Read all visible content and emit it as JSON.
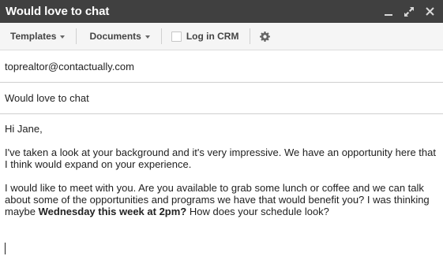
{
  "window": {
    "title": "Would love to chat",
    "controls": [
      {
        "name": "minimize-icon"
      },
      {
        "name": "expand-icon"
      },
      {
        "name": "close-icon"
      }
    ]
  },
  "toolbar": {
    "templates_label": "Templates",
    "documents_label": "Documents",
    "log_in_crm_label": "Log in CRM",
    "log_in_crm_checked": false,
    "settings_icon": "gear-icon"
  },
  "fields": {
    "to": "toprealtor@contactually.com",
    "subject": "Would love to chat"
  },
  "message": {
    "greeting": "Hi Jane,",
    "paragraph1": "I've taken a look at your background and it's very impressive. We have an opportunity here that I think would expand on your experience.",
    "paragraph2_before": "I would like to meet with you. Are you available to grab some lunch or coffee and we can talk about some of the opportunities and programs we have that would benefit you? I was thinking maybe ",
    "paragraph2_bold": "Wednesday this week at 2pm?",
    "paragraph2_after": " How does your schedule look?"
  }
}
